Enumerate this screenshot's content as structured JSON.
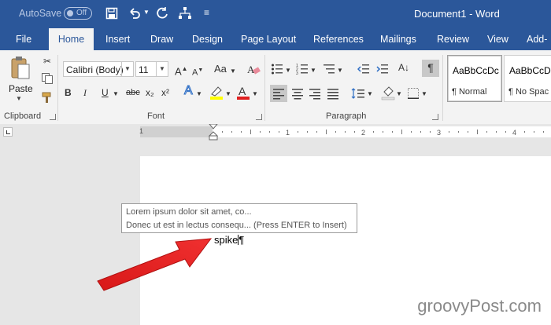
{
  "titlebar": {
    "autosave_label": "AutoSave",
    "autosave_state": "Off",
    "doc_title": "Document1 - Word"
  },
  "tabs": [
    "File",
    "Home",
    "Insert",
    "Draw",
    "Design",
    "Page Layout",
    "References",
    "Mailings",
    "Review",
    "View",
    "Add-"
  ],
  "clipboard": {
    "paste_label": "Paste",
    "group_label": "Clipboard"
  },
  "font": {
    "name": "Calibri (Body)",
    "size": "11",
    "change_case": "Aa",
    "group_label": "Font",
    "bold": "B",
    "italic": "I",
    "underline": "U",
    "strike": "abc",
    "subscript": "x₂",
    "superscript": "x²"
  },
  "paragraph": {
    "group_label": "Paragraph",
    "pilcrow": "¶"
  },
  "styles": [
    {
      "sample": "AaBbCcDc",
      "name": "¶ Normal"
    },
    {
      "sample": "AaBbCcDc",
      "name": "¶ No Spac"
    }
  ],
  "ruler": {
    "numbers": [
      "1",
      "1",
      "2",
      "3",
      "4"
    ]
  },
  "tooltip": {
    "line1": "Lorem ipsum dolor sit amet, co...",
    "line2": "Donec ut est in lectus consequ... (Press ENTER to Insert)"
  },
  "document": {
    "text": "spike",
    "pilcrow": "¶"
  },
  "colors": {
    "accent": "#2b579a",
    "arrow": "#e02020",
    "highlight": "#ffff00",
    "font_color": "#e02020"
  },
  "watermark": "groovyPost.com"
}
